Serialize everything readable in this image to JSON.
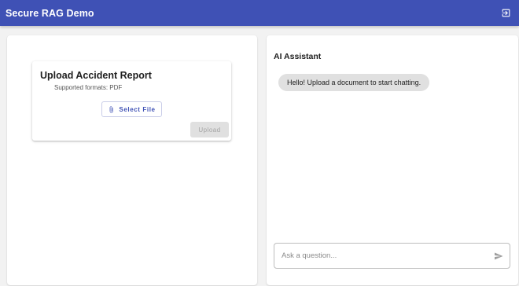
{
  "app": {
    "title": "Secure RAG Demo",
    "logout_icon": "logout-icon"
  },
  "upload": {
    "title": "Upload Accident Report",
    "supported_formats": "Supported formats: PDF",
    "select_file_label": "Select File",
    "select_file_icon": "paperclip-icon",
    "upload_label": "Upload",
    "upload_enabled": false
  },
  "chat": {
    "title": "AI Assistant",
    "messages": [
      {
        "role": "assistant",
        "text": "Hello! Upload a document to start chatting."
      }
    ],
    "input_value": "",
    "input_placeholder": "Ask a question...",
    "send_icon": "send-icon"
  },
  "colors": {
    "primary": "#3f51b5",
    "background": "#f2f2f2",
    "bubble": "#e0e0e0",
    "disabled_button": "#e0e0e0"
  }
}
